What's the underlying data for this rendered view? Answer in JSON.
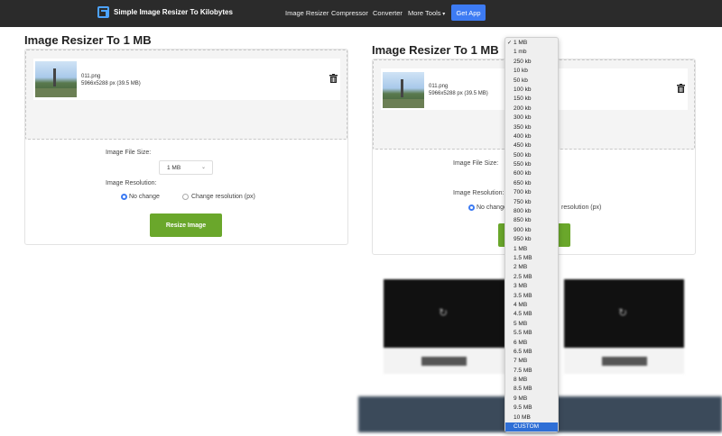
{
  "nav": {
    "brand": "Simple Image Resizer To Kilobytes",
    "links": [
      "Image Resizer",
      "Compressor",
      "Converter",
      "More Tools"
    ],
    "get_app": "Get App"
  },
  "left": {
    "title": "Image Resizer To 1 MB",
    "file_name": "011.png",
    "file_dims": "5966x5288 px (39.5 MB)",
    "file_size_label": "Image File Size:",
    "select_value": "1 MB",
    "resolution_label": "Image Resolution:",
    "radio_no_change": "No change",
    "radio_change": "Change resolution (px)",
    "resize_button": "Resize Image"
  },
  "right": {
    "title": "Image Resizer To 1 MB",
    "file_name": "011.png",
    "file_dims": "5966x5288 px (39.5 MB)",
    "file_size_label": "Image File Size:",
    "resolution_label": "Image Resolution:",
    "radio_no_change": "No change",
    "radio_change_partial": "resolution (px)"
  },
  "dropdown": {
    "checked": "1 MB",
    "selected": "CUSTOM",
    "options": [
      "1 MB",
      "1 mb",
      "250 kb",
      "10 kb",
      "50 kb",
      "100 kb",
      "150 kb",
      "200 kb",
      "300 kb",
      "350 kb",
      "400 kb",
      "450 kb",
      "500 kb",
      "550 kb",
      "600 kb",
      "650 kb",
      "700 kb",
      "750 kb",
      "800 kb",
      "850 kb",
      "900 kb",
      "950 kb",
      "1 MB",
      "1.5 MB",
      "2 MB",
      "2.5 MB",
      "3 MB",
      "3.5 MB",
      "4 MB",
      "4.5 MB",
      "5 MB",
      "5.5 MB",
      "6 MB",
      "6.5 MB",
      "7 MB",
      "7.5 MB",
      "8 MB",
      "8.5 MB",
      "9 MB",
      "9.5 MB",
      "10 MB",
      "CUSTOM"
    ]
  },
  "colors": {
    "navbar": "#2b2b2b",
    "accent_blue": "#3d7bf3",
    "button_green": "#6aa72b",
    "selected_option": "#2f6fd6"
  }
}
